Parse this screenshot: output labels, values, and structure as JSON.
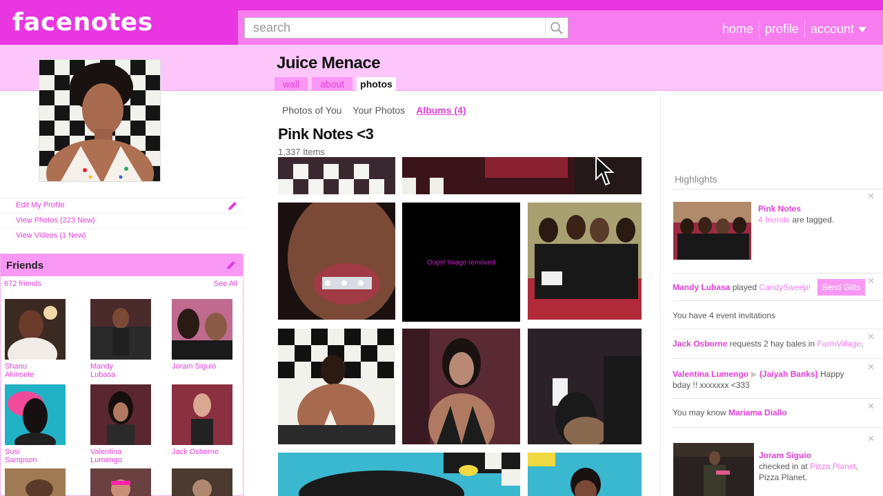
{
  "header": {
    "logo": "facenotes",
    "search_placeholder": "search",
    "nav": [
      "home",
      "profile",
      "account"
    ]
  },
  "profile": {
    "name": "Juice Menace",
    "tabs": [
      "wall",
      "about",
      "photos"
    ],
    "links": [
      "Edit My Profile",
      "View Photos (223 New)",
      "View Videos (1 New)"
    ]
  },
  "friends": {
    "title": "Friends",
    "count": "672 friends",
    "see_all": "See All",
    "list": [
      {
        "name": "Shanu Akinsete"
      },
      {
        "name": "Mandy Lubasa"
      },
      {
        "name": "Joram Siguio"
      },
      {
        "name": "Susi Sampson"
      },
      {
        "name": "Valentina Lumengo"
      },
      {
        "name": "Jack Osborne"
      }
    ]
  },
  "photos": {
    "tabs": [
      "Photos of You",
      "Your Photos",
      "Albums (4)"
    ],
    "album_title": "Pink Notes <3",
    "album_count": "1,337 Items",
    "removed_text": "Oops! Image removed"
  },
  "highlights": {
    "title": "Highlights",
    "items": [
      {
        "name": "Pink Notes",
        "link": "4 friends",
        "text": "are tagged."
      },
      {
        "name": "Mandy Lubasa",
        "text": "played",
        "link": "CandySweep!",
        "button": "Send Gifts"
      },
      {
        "text": "You have 4 event invitations"
      },
      {
        "name": "Jack Osborne",
        "text": "requests 2 hay bales in",
        "link": "FarmVillage",
        "end": "."
      },
      {
        "name": "Valentina Lumengo",
        "name2": "(Jaiyah Banks)",
        "text": "Happy bday !! xxxxxxx <333"
      },
      {
        "text": "You may know",
        "name": "Mariama Diallo"
      },
      {
        "name": "Joram Siguio",
        "text": "checked in at",
        "link": "Pizza Planet",
        "end": ",",
        "text2": "Pizza Planet."
      }
    ]
  },
  "colors": {
    "brand_dark": "#e836e0",
    "brand": "#f77cf0",
    "band": "#fdc6fb",
    "link": "#e03fd8"
  }
}
